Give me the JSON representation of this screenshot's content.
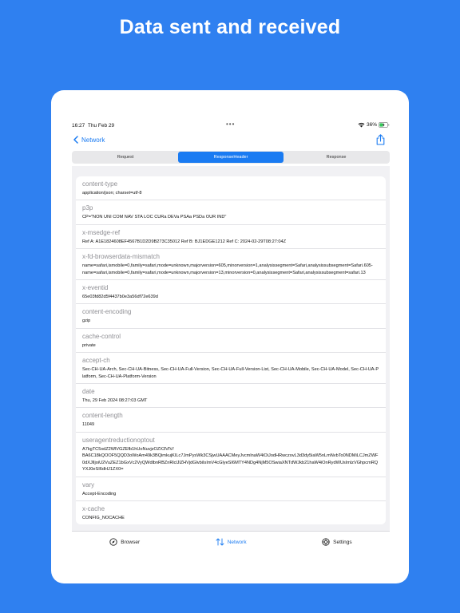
{
  "headline": "Data sent and received",
  "status_bar": {
    "time": "16:27",
    "date": "Thu Feb 29",
    "battery": "36%"
  },
  "nav": {
    "back_label": "Network"
  },
  "segments": [
    "Request",
    "ResponseHeader",
    "Response"
  ],
  "active_segment": "ResponseHeader",
  "headers": [
    {
      "key": "content-type",
      "value": "application/json; charset=utf-8"
    },
    {
      "key": "p3p",
      "value": "CP=\"NON UNI COM NAV STA LOC CURa DEVa PSAa PSDa OUR IND\""
    },
    {
      "key": "x-msedge-ref",
      "value": "Ref A: A1E1824608EF4567B1D2D9B273C35012 Ref B: BJ1EDGE1212 Ref C: 2024-02-29T08:27:04Z"
    },
    {
      "key": "x-fd-browserdata-mismatch",
      "value": "name=safari,ismobile=0,family=safari,mode=unknown,majorversion=605,minorversion=1,analysissegment=Safari,analysissubsegment=Safari.605-\nname=safari,ismobile=0,family=safari,mode=unknown,majorversion=13,minorversion=0,analysissegment=Safari,analysissubsegment=safari.13"
    },
    {
      "key": "x-eventid",
      "value": "65e03fd82d5f4437b0e3a56df72e639d"
    },
    {
      "key": "content-encoding",
      "value": "gzip"
    },
    {
      "key": "cache-control",
      "value": "private"
    },
    {
      "key": "accept-ch",
      "value": "Sec-CH-UA-Arch, Sec-CH-UA-Bitness, Sec-CH-UA-Full-Version, Sec-CH-UA-Full-Version-List, Sec-CH-UA-Mobile, Sec-CH-UA-Model, Sec-CH-UA-Platform, Sec-CH-UA-Platform-Version"
    },
    {
      "key": "date",
      "value": "Thu, 29 Feb 2024 08:27:03 GMT"
    },
    {
      "key": "content-length",
      "value": "11049"
    },
    {
      "key": "useragentreductionoptout",
      "value": "A7kgTC5xdZ2WlVGZEfb1hUoNuvjzOZX3VIV/\nBA6C18kQOOF5QQD3oWoAm49k3BQimkujKILc7JmPysWk3CSjwUAAACMeyJvcmlnaW4iOiJodHRwczovL3d3dy5iaW5nLmNvbTo0NDMiLCJmZWF0dXJlIjoiU2VuZEZ1bGxVc2VyQWdlbnRBZnRlclJlZHVjdGlvbiIsImV4cGlyeSI6MTY4NDg4NjM5OSwiaXNTdWJkb21haW4iOnRydWUsImlzVGhpcmRQYXJ0eSI6dHJ1ZX0="
    },
    {
      "key": "vary",
      "value": "Accept-Encoding"
    },
    {
      "key": "x-cache",
      "value": "CONFIG_NOCACHE"
    }
  ],
  "tabs": [
    {
      "label": "Browser",
      "icon": "compass-icon"
    },
    {
      "label": "Network",
      "icon": "arrows-updown-icon"
    },
    {
      "label": "Settings",
      "icon": "gear-icon"
    }
  ],
  "active_tab": "Network",
  "colors": {
    "background": "#2f80f0",
    "accent": "#1a7bf2"
  }
}
